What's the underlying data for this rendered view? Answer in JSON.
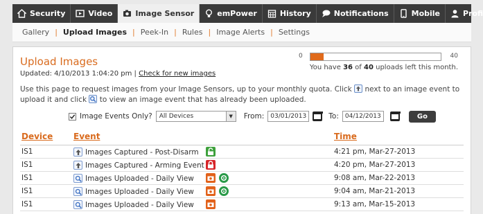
{
  "nav": {
    "tabs": [
      {
        "label": "Security",
        "icon": "home-icon"
      },
      {
        "label": "Video",
        "icon": "video-icon"
      },
      {
        "label": "Image Sensor",
        "icon": "camera-icon",
        "active": true
      },
      {
        "label": "emPower",
        "icon": "lightbulb-icon"
      },
      {
        "label": "History",
        "icon": "calendar-icon"
      },
      {
        "label": "Notifications",
        "icon": "chat-bubble-icon"
      },
      {
        "label": "Mobile",
        "icon": "phone-icon"
      },
      {
        "label": "Profile",
        "icon": "person-icon"
      }
    ]
  },
  "subnav": {
    "items": [
      "Gallery",
      "Upload Images",
      "Peek-In",
      "Rules",
      "Image Alerts",
      "Settings"
    ],
    "active": "Upload Images"
  },
  "page": {
    "title": "Upload Images",
    "updated_prefix": "Updated: 4/10/2013 1:04:20 pm |",
    "check_link": "Check for new images",
    "desc_part1": "Use this page to request images from your Image Sensors, up to your monthly quota. Click",
    "desc_part2": "next to an image event to upload it and click",
    "desc_part3": "to view an image event that has already been uploaded."
  },
  "quota": {
    "min": "0",
    "max": "40",
    "used_fraction": 0.1,
    "text_prefix": "You have",
    "remaining": "36",
    "text_of": "of",
    "total": "40",
    "text_suffix": "uploads left this month."
  },
  "filters": {
    "checkbox_label": "Image Events Only?",
    "checkbox_checked": true,
    "device_select": "All Devices",
    "from_label": "From:",
    "from_value": "03/01/2013",
    "to_label": "To:",
    "to_value": "04/12/2013",
    "go_label": "Go"
  },
  "table": {
    "headers": {
      "device": "Device",
      "event": "Event",
      "time": "Time"
    },
    "rows": [
      {
        "device": "IS1",
        "action": "upload",
        "event": "Images Captured - Post-Disarm",
        "icons": [
          "unlock-icon"
        ],
        "time": "4:21 pm, Mar-27-2013"
      },
      {
        "device": "IS1",
        "action": "upload",
        "event": "Images Captured - Arming Event",
        "icons": [
          "lock-icon"
        ],
        "time": "4:20 pm, Mar-27-2013"
      },
      {
        "device": "IS1",
        "action": "view",
        "event": "Images Uploaded - Daily View",
        "icons": [
          "camera-orange-icon",
          "refresh-icon"
        ],
        "time": "9:08 am, Mar-22-2013"
      },
      {
        "device": "IS1",
        "action": "view",
        "event": "Images Uploaded - Daily View",
        "icons": [
          "camera-orange-icon",
          "refresh-icon"
        ],
        "time": "9:04 am, Mar-21-2013"
      },
      {
        "device": "IS1",
        "action": "view",
        "event": "Images Uploaded - Daily View",
        "icons": [
          "camera-orange-icon"
        ],
        "time": "9:13 am, Mar-15-2013"
      }
    ]
  },
  "colors": {
    "accent": "#d96b1e",
    "nav_bg": "#3a3a3a"
  }
}
